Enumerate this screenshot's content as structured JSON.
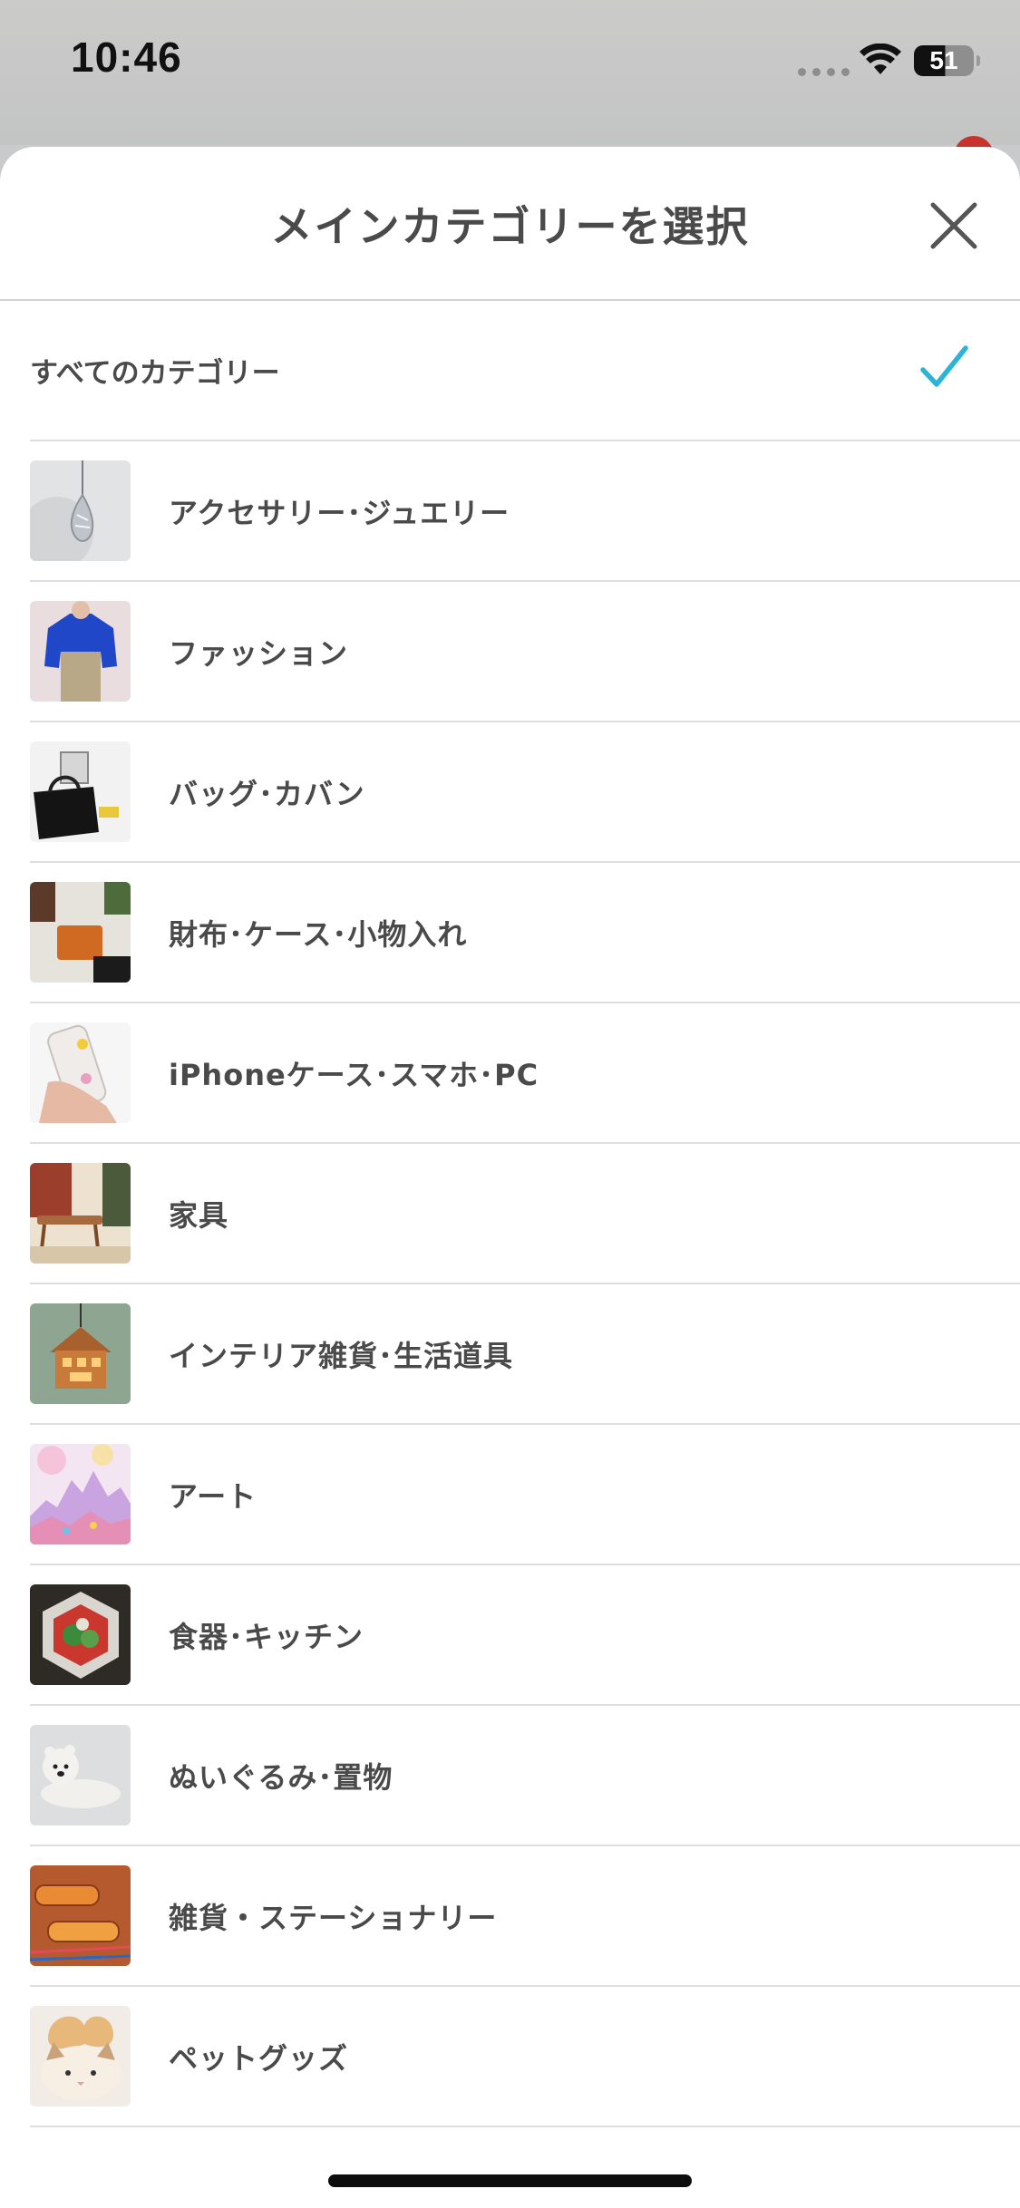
{
  "status_bar": {
    "time": "10:46",
    "battery": "51",
    "icons": [
      "signal-dots-icon",
      "wifi-icon",
      "battery-icon"
    ]
  },
  "sheet": {
    "title": "メインカテゴリーを選択",
    "close_icon": "close-icon",
    "all_categories": {
      "label": "すべてのカテゴリー",
      "selected": true,
      "check_icon": "checkmark-icon",
      "check_color": "#2cb3d6"
    },
    "categories": [
      {
        "label": "アクセサリー･ジュエリー"
      },
      {
        "label": "ファッション"
      },
      {
        "label": "バッグ･カバン"
      },
      {
        "label": "財布･ケース･小物入れ"
      },
      {
        "label": "iPhoneケース･スマホ･PC"
      },
      {
        "label": "家具"
      },
      {
        "label": "インテリア雑貨･生活道具"
      },
      {
        "label": "アート"
      },
      {
        "label": "食器･キッチン"
      },
      {
        "label": "ぬいぐるみ･置物"
      },
      {
        "label": "雑貨・ステーショナリー"
      },
      {
        "label": "ペットグッズ"
      }
    ]
  }
}
